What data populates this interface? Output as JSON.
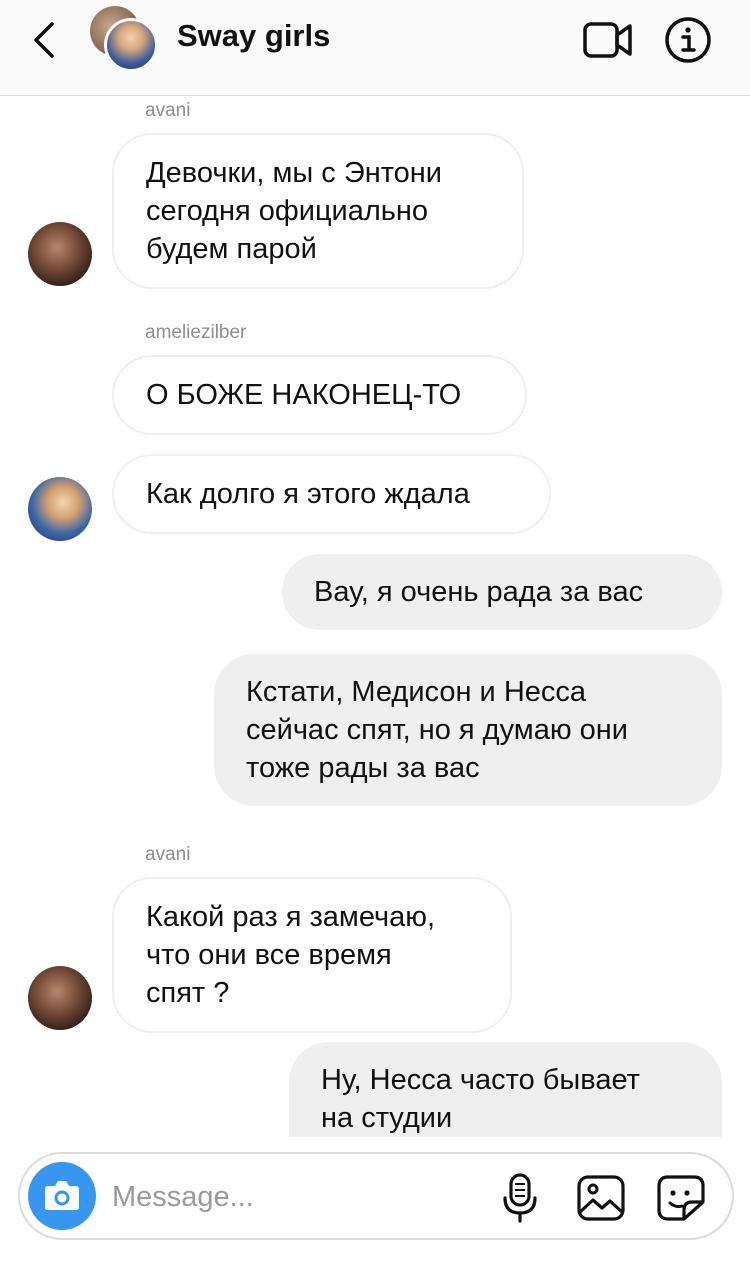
{
  "header": {
    "title": "Sway girls",
    "back_icon": "chevron-left-icon",
    "video_icon": "video-camera-icon",
    "info_icon": "info-icon"
  },
  "messages": [
    {
      "sender": "avani",
      "text": "Девочки, мы с Энтони\nсегодня официально\nбудем парой"
    },
    {
      "sender": "ameliezilber",
      "text": "О БОЖЕ НАКОНЕЦ-ТО"
    },
    {
      "text": "Как долго я этого ждала"
    },
    {
      "text": "Вау, я очень рада за вас"
    },
    {
      "text": "Кстати, Медисон и Несса\nсейчас спят, но я думаю они\nтоже рады за вас"
    },
    {
      "sender": "avani",
      "text": "Какой раз я замечаю,\nчто они все время\nспят ?"
    },
    {
      "text": "Ну, Несса часто бывает\nна студии"
    }
  ],
  "composer": {
    "placeholder": "Message...",
    "camera_icon": "camera-icon",
    "mic_icon": "microphone-icon",
    "gallery_icon": "image-icon",
    "sticker_icon": "sticker-icon",
    "accent_color": "#3797f0"
  }
}
